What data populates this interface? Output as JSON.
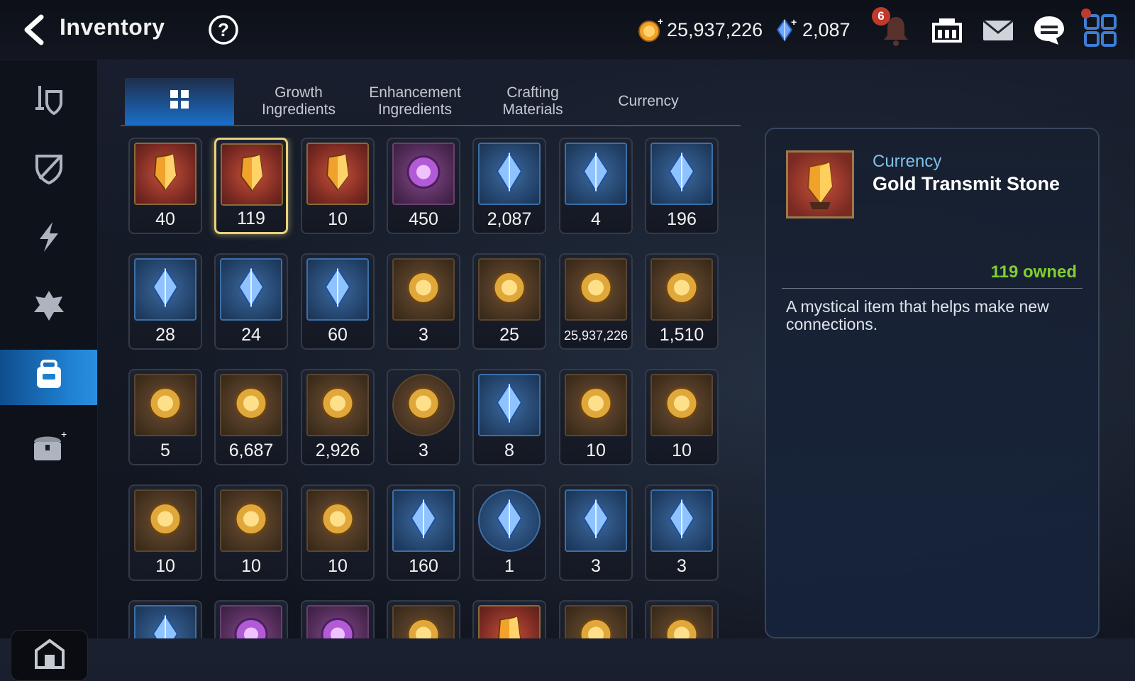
{
  "header": {
    "title": "Inventory",
    "gold": "25,937,226",
    "gems": "2,087",
    "notification_count": "6",
    "icons": [
      "back-arrow-icon",
      "help-icon",
      "gold-coin-icon",
      "crystal-icon",
      "bell-icon",
      "guild-hall-icon",
      "mail-icon",
      "chat-icon",
      "menu-grid-icon"
    ]
  },
  "sidebar": {
    "items": [
      {
        "icon": "weapon-armor-icon"
      },
      {
        "icon": "shield-broken-icon"
      },
      {
        "icon": "lightning-icon"
      },
      {
        "icon": "crest-icon"
      },
      {
        "icon": "bag-icon",
        "active": true
      },
      {
        "icon": "chest-icon"
      }
    ],
    "bottom_icon": "storage-icon"
  },
  "tabs": [
    {
      "label": "",
      "icon": "grid-icon",
      "active": true
    },
    {
      "label": "Growth\nIngredients"
    },
    {
      "label": "Enhancement\nIngredients"
    },
    {
      "label": "Crafting\nMaterials"
    },
    {
      "label": "Currency"
    }
  ],
  "items": [
    {
      "qty": "40",
      "icon": "eye-emblem-icon",
      "color": "red"
    },
    {
      "qty": "119",
      "icon": "gold-transmit-stone-icon",
      "color": "red",
      "selected": true
    },
    {
      "qty": "10",
      "icon": "ring-amulet-icon",
      "color": "red"
    },
    {
      "qty": "450",
      "icon": "flower-ring-icon",
      "color": "purple"
    },
    {
      "qty": "2,087",
      "icon": "blue-crystal-icon",
      "color": "blue"
    },
    {
      "qty": "4",
      "icon": "green-crystal-icon",
      "color": "blue"
    },
    {
      "qty": "196",
      "icon": "leaf-icon",
      "color": "blue"
    },
    {
      "qty": "28",
      "icon": "certificate-card-icon",
      "color": "blue"
    },
    {
      "qty": "24",
      "icon": "star-charm-icon",
      "color": "blue"
    },
    {
      "qty": "60",
      "icon": "pet-card-icon",
      "color": "blue"
    },
    {
      "qty": "3",
      "icon": "sword-seal-icon",
      "color": "brown"
    },
    {
      "qty": "25",
      "icon": "green-heart-icon",
      "color": "brown"
    },
    {
      "qty": "25,937,226",
      "icon": "gold-coin-icon",
      "color": "brown",
      "small": true
    },
    {
      "qty": "1,510",
      "icon": "fist-emblem-icon",
      "color": "brown"
    },
    {
      "qty": "5",
      "icon": "banner-icon",
      "color": "brown"
    },
    {
      "qty": "6,687",
      "icon": "horse-chess-icon",
      "color": "brown"
    },
    {
      "qty": "2,926",
      "icon": "red-leaf-icon",
      "color": "brown"
    },
    {
      "qty": "3",
      "icon": "chick-portrait-icon",
      "color": "brown",
      "round": true
    },
    {
      "qty": "8",
      "icon": "gold-flower-icon",
      "color": "blue"
    },
    {
      "qty": "10",
      "icon": "pink-orb-icon",
      "color": "brown"
    },
    {
      "qty": "10",
      "icon": "red-orb-icon",
      "color": "brown"
    },
    {
      "qty": "10",
      "icon": "cyan-rune-icon",
      "color": "brown"
    },
    {
      "qty": "10",
      "icon": "yellow-rune-icon",
      "color": "brown"
    },
    {
      "qty": "10",
      "icon": "green-rune-icon",
      "color": "brown"
    },
    {
      "qty": "160",
      "icon": "ginseng-icon",
      "color": "blue"
    },
    {
      "qty": "1",
      "icon": "blue-portal-icon",
      "color": "blue",
      "round": true
    },
    {
      "qty": "3",
      "icon": "pink-jewel-box-icon",
      "color": "blue"
    },
    {
      "qty": "3",
      "icon": "blue-jewel-box-icon",
      "color": "blue"
    },
    {
      "qty": "",
      "icon": "green-box-icon",
      "color": "blue"
    },
    {
      "qty": "",
      "icon": "purple-badge-icon",
      "color": "purple"
    },
    {
      "qty": "",
      "icon": "purple-badge-icon",
      "color": "purple"
    },
    {
      "qty": "",
      "icon": "feather-icon",
      "color": "brown"
    },
    {
      "qty": "",
      "icon": "red-hex-icon",
      "color": "red"
    },
    {
      "qty": "",
      "icon": "dark-box-icon",
      "color": "brown"
    },
    {
      "qty": "",
      "icon": "dark-box-icon",
      "color": "brown"
    }
  ],
  "detail": {
    "category": "Currency",
    "name": "Gold Transmit Stone",
    "owned": "119 owned",
    "description": "A mystical item that helps make new connections."
  },
  "colors": {
    "accent_blue": "#1a6ec8",
    "owned_green": "#7fd02e",
    "category_blue": "#7ec1e8",
    "selection_gold": "#e9d27a"
  }
}
